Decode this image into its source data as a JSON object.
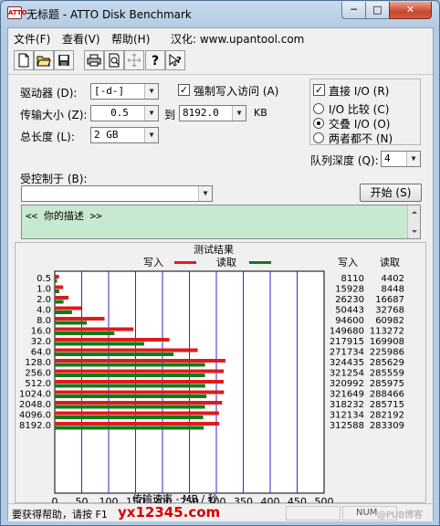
{
  "window": {
    "title": "无标题 - ATTO Disk Benchmark",
    "app_icon_text": "ATTO"
  },
  "caption": {
    "minimize": "─",
    "maximize": "□",
    "close": "✕"
  },
  "menu": [
    {
      "label": "文件(F)"
    },
    {
      "label": "查看(V)"
    },
    {
      "label": "帮助(H)"
    },
    {
      "label": "汉化: www.upantool.com"
    }
  ],
  "toolbar": [
    "new-icon",
    "open-icon",
    "save-icon",
    "print-icon",
    "print-preview-icon",
    "move-icon",
    "help-icon",
    "context-help-icon"
  ],
  "settings": {
    "drive": {
      "label": "驱动器 (D):",
      "value": "[-d-]"
    },
    "transfer": {
      "label": "传输大小 (Z):",
      "from": "0.5",
      "to_label": "到",
      "to": "8192.0",
      "unit": "KB"
    },
    "length": {
      "label": "总长度 (L):",
      "value": "2 GB"
    },
    "force_write": {
      "label": "强制写入访问 (A)",
      "checked": true
    },
    "direct_io": {
      "label": "直接 I/O (R)",
      "checked": true
    },
    "io_compare": {
      "label": "I/O 比较 (C)"
    },
    "overlapped_io": {
      "label": "交叠 I/O (O)"
    },
    "neither": {
      "label": "两者都不 (N)"
    },
    "queue_depth": {
      "label": "队列深度 (Q):",
      "value": "4"
    },
    "controlled_by": {
      "label": "受控制于 (B):",
      "value": ""
    },
    "start_button": "开始 (S)",
    "description": "<<  你的描述   >>"
  },
  "results": {
    "title": "测试结果",
    "legend_write": "写入",
    "legend_read": "读取",
    "col_write": "写入",
    "col_read": "读取",
    "xlabel": "传输速率 - MB / 秒",
    "write_color": "#e01a1a",
    "read_color": "#137a17"
  },
  "chart_data": {
    "type": "bar",
    "orientation": "horizontal",
    "title": "测试结果",
    "xlabel": "传输速率 - MB / 秒",
    "xlim": [
      0,
      500
    ],
    "xticks": [
      0,
      50,
      100,
      150,
      200,
      250,
      300,
      350,
      400,
      450,
      500
    ],
    "categories": [
      "0.5",
      "1.0",
      "2.0",
      "4.0",
      "8.0",
      "16.0",
      "32.0",
      "64.0",
      "128.0",
      "256.0",
      "512.0",
      "1024.0",
      "2048.0",
      "4096.0",
      "8192.0"
    ],
    "series": [
      {
        "name": "写入",
        "values": [
          8110,
          15928,
          26230,
          50443,
          94600,
          149680,
          217915,
          271734,
          324435,
          321254,
          320992,
          321649,
          318232,
          312134,
          312588
        ]
      },
      {
        "name": "读取",
        "values": [
          4402,
          8448,
          16687,
          32768,
          60982,
          113272,
          169908,
          225986,
          285629,
          285559,
          285975,
          288466,
          285715,
          282192,
          283309
        ]
      }
    ],
    "grid": true
  },
  "status": {
    "text": "要获得帮助，请按 F1",
    "watermark": "yx12345.com",
    "num": "NUM",
    "right_mark": "@PUB博客"
  }
}
